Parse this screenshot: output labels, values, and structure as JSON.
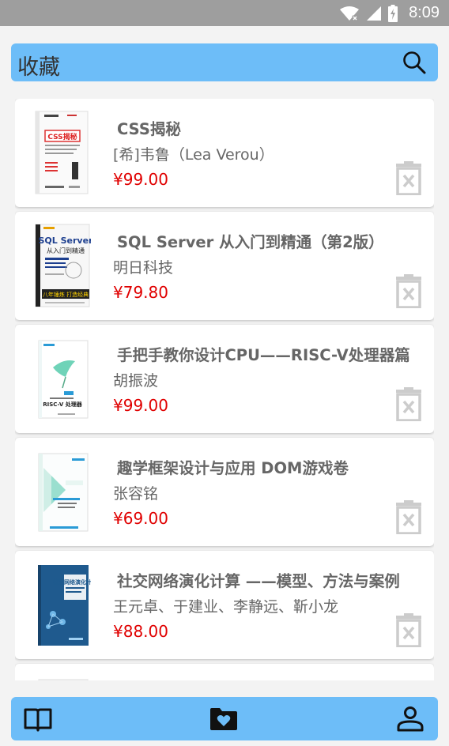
{
  "status_bar": {
    "time": "8:09",
    "icons": [
      "wifi-icon",
      "signal-icon",
      "battery-icon"
    ]
  },
  "header": {
    "title": "收藏",
    "search_icon": "search-icon"
  },
  "colors": {
    "accent": "#6dbdf8",
    "price": "#e00000",
    "status_bar": "#9e9e9e",
    "background": "#f3f3f3"
  },
  "books": [
    {
      "title": "CSS揭秘",
      "author": "[希]韦鲁（Lea Verou）",
      "price": "¥99.00"
    },
    {
      "title": "SQL Server 从入门到精通（第2版）",
      "author": "明日科技",
      "price": "¥79.80"
    },
    {
      "title": "手把手教你设计CPU——RISC-V处理器篇",
      "author": "胡振波",
      "price": "¥99.00"
    },
    {
      "title": "趣学框架设计与应用 DOM游戏卷",
      "author": "张容铭",
      "price": "¥69.00"
    },
    {
      "title": "社交网络演化计算 ——模型、方法与案例",
      "author": "王元卓、于建业、李静远、靳小龙",
      "price": "¥88.00"
    }
  ],
  "covers": [
    {
      "label": "CSS揭秘"
    },
    {
      "label": "SQL Server",
      "sub": "从入门到精通",
      "slogan": "八年锤炼 打造经典"
    },
    {
      "label": "RISC-V 处理器"
    },
    {
      "label": ""
    },
    {
      "label": "社交网络演化计算"
    }
  ],
  "bottom_nav": {
    "items": [
      "book-icon",
      "folder-heart-icon",
      "user-icon"
    ]
  }
}
